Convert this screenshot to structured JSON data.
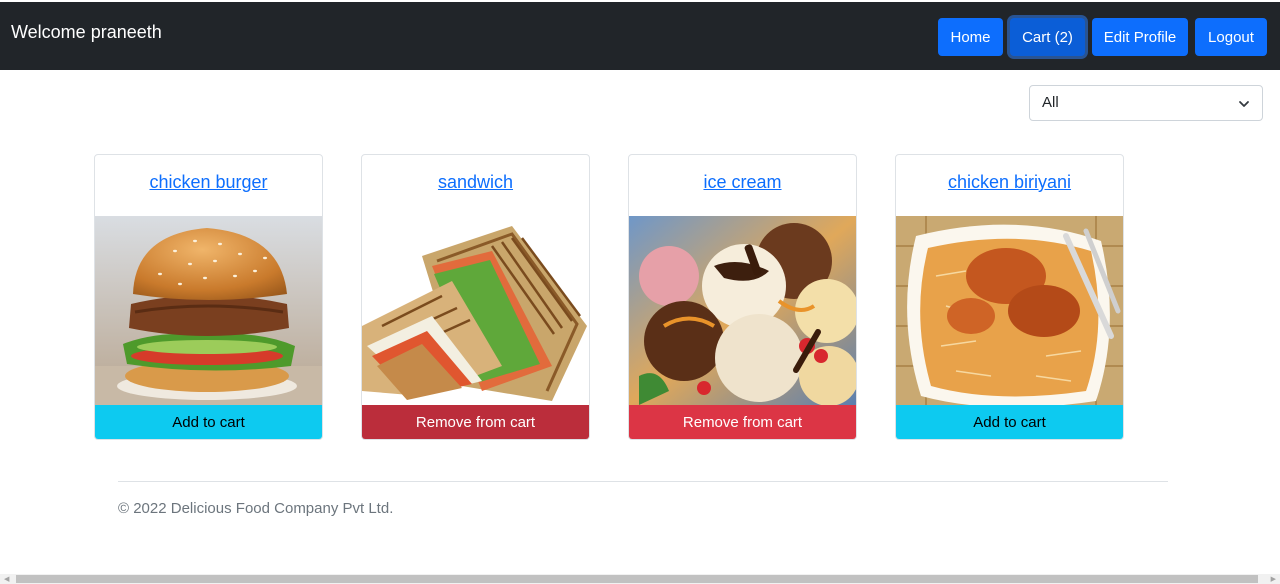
{
  "header": {
    "welcome": "Welcome praneeth",
    "nav": {
      "home": "Home",
      "cart": "Cart (2)",
      "edit_profile": "Edit Profile",
      "logout": "Logout"
    }
  },
  "filter": {
    "selected": "All"
  },
  "products": [
    {
      "name": "chicken burger",
      "action": "Add to cart"
    },
    {
      "name": "sandwich",
      "action": "Remove from cart"
    },
    {
      "name": "ice cream",
      "action": "Remove from cart"
    },
    {
      "name": "chicken biriyani",
      "action": "Add to cart"
    }
  ],
  "footer": {
    "text": "© 2022 Delicious Food Company Pvt Ltd."
  },
  "colors": {
    "navbar": "#212529",
    "primary": "#0d6efd",
    "info": "#0dcaf0",
    "danger": "#dc3545"
  }
}
